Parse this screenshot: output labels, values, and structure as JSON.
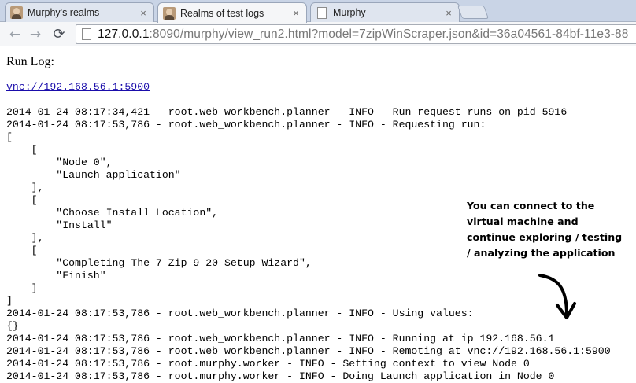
{
  "tabs": [
    {
      "label": "Murphy's realms",
      "icon": "avatar-favicon-icon",
      "close": "×"
    },
    {
      "label": "Realms of test logs",
      "icon": "avatar-favicon-icon",
      "close": "×"
    },
    {
      "label": "Murphy",
      "icon": "page-icon",
      "close": "×"
    }
  ],
  "toolbar": {
    "back": "←",
    "forward": "→",
    "reload": "⟳",
    "url_host": "127.0.0.1",
    "url_rest": ":8090/murphy/view_run2.html?model=7zipWinScraper.json&id=36a04561-84bf-11e3-88"
  },
  "page": {
    "title": "Run Log:",
    "vnc_link": "vnc://192.168.56.1:5900",
    "log_lines": [
      "2014-01-24 08:17:34,421 - root.web_workbench.planner - INFO - Run request runs on pid 5916",
      "2014-01-24 08:17:53,786 - root.web_workbench.planner - INFO - Requesting run:",
      "[",
      "    [",
      "        \"Node 0\",",
      "        \"Launch application\"",
      "    ],",
      "    [",
      "        \"Choose Install Location\",",
      "        \"Install\"",
      "    ],",
      "    [",
      "        \"Completing The 7_Zip 9_20 Setup Wizard\",",
      "        \"Finish\"",
      "    ]",
      "]",
      "2014-01-24 08:17:53,786 - root.web_workbench.planner - INFO - Using values:",
      "{}",
      "2014-01-24 08:17:53,786 - root.web_workbench.planner - INFO - Running at ip 192.168.56.1",
      "2014-01-24 08:17:53,786 - root.web_workbench.planner - INFO - Remoting at vnc://192.168.56.1:5900",
      "2014-01-24 08:17:53,786 - root.murphy.worker - INFO - Setting context to view Node 0",
      "2014-01-24 08:17:53,786 - root.murphy.worker - INFO - Doing Launch application in Node 0"
    ],
    "annotation": "You can connect to the virtual machine and continue exploring / testing / analyzing the application"
  }
}
